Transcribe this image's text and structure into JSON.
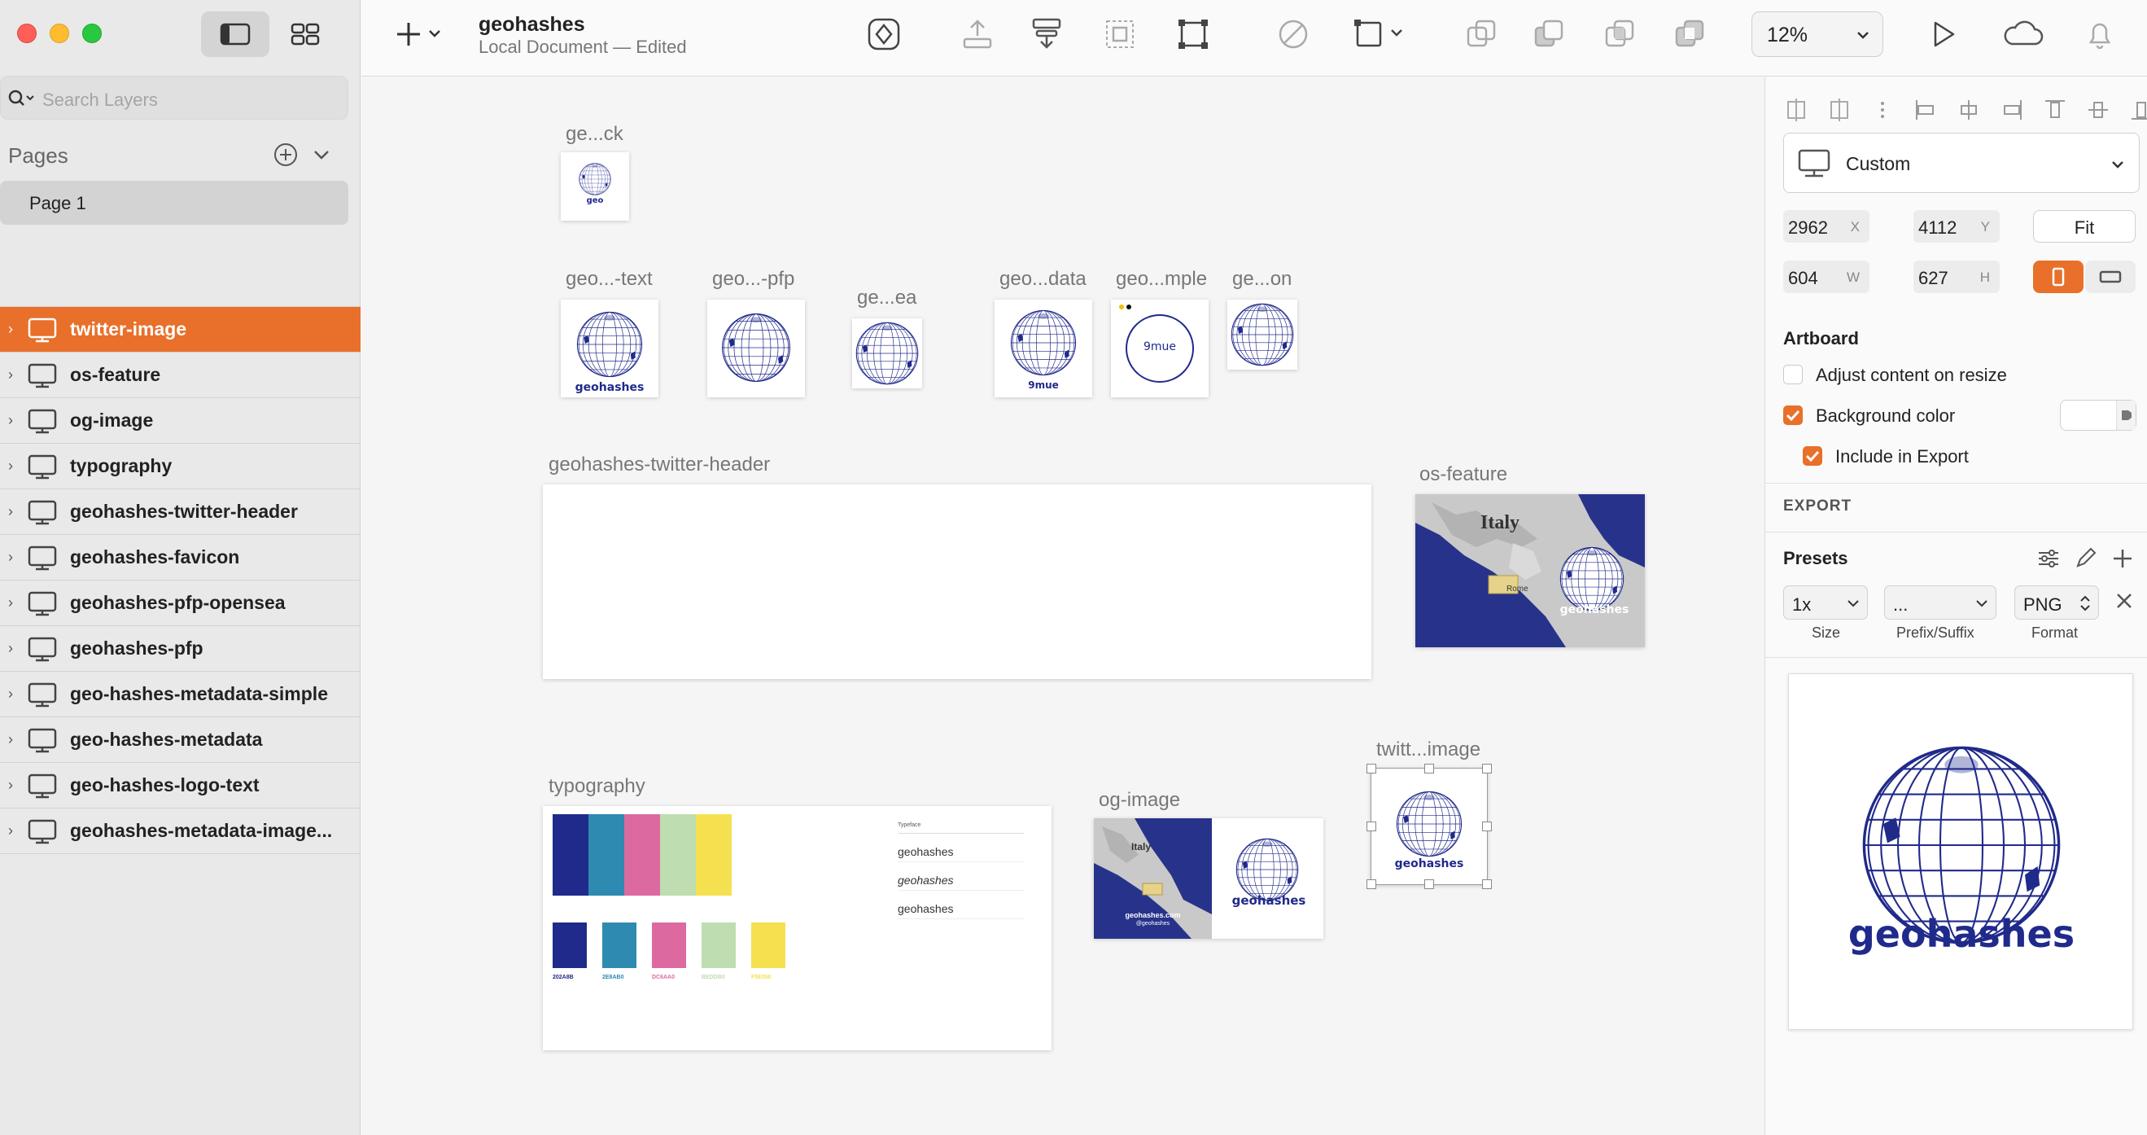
{
  "sidebar": {
    "search_placeholder": "Search Layers",
    "pages_title": "Pages",
    "pages": [
      "Page 1"
    ],
    "layers": [
      {
        "name": "twitter-image",
        "selected": true
      },
      {
        "name": "os-feature",
        "selected": false
      },
      {
        "name": "og-image",
        "selected": false
      },
      {
        "name": "typography",
        "selected": false
      },
      {
        "name": "geohashes-twitter-header",
        "selected": false
      },
      {
        "name": "geohashes-favicon",
        "selected": false
      },
      {
        "name": "geohashes-pfp-opensea",
        "selected": false
      },
      {
        "name": "geohashes-pfp",
        "selected": false
      },
      {
        "name": "geo-hashes-metadata-simple",
        "selected": false
      },
      {
        "name": "geo-hashes-metadata",
        "selected": false
      },
      {
        "name": "geo-hashes-logo-text",
        "selected": false
      },
      {
        "name": "geohashes-metadata-image..."
      }
    ]
  },
  "toolbar": {
    "doc_title": "geohashes",
    "doc_subtitle": "Local Document — Edited",
    "zoom": "12%"
  },
  "canvas": {
    "artboards": {
      "favicon_label": "ge...ck",
      "logo_text_label": "geo...-text",
      "pfp_label": "geo...-pfp",
      "opensea_label": "ge...ea",
      "metadata_label": "geo...data",
      "simple_label": "geo...mple",
      "image_label": "ge...on",
      "twitter_header_label": "geohashes-twitter-header",
      "os_feature_label": "os-feature",
      "typography_label": "typography",
      "og_image_label": "og-image",
      "twitter_image_label": "twitt...image"
    },
    "text": {
      "geo": "geo",
      "geohashes": "geohashes",
      "nine_mue": "9mue",
      "italy": "Italy",
      "rome": "Rome",
      "og_site": "geohashes.com",
      "og_handle": "@geohashes",
      "typeface": "Typeface",
      "sample": "geohashes"
    },
    "swatches": [
      {
        "hex": "#202A8B",
        "label": "202A8B"
      },
      {
        "hex": "#2E8AB0",
        "label": "2E8AB0"
      },
      {
        "hex": "#DC6AA0",
        "label": "DC6AA0"
      },
      {
        "hex": "#BEDDB0",
        "label": "BEDDB0"
      },
      {
        "hex": "#F5E050",
        "label": "F5E050"
      }
    ]
  },
  "inspector": {
    "preset_name": "Custom",
    "x_value": "2962",
    "x_label": "X",
    "y_value": "4112",
    "y_label": "Y",
    "w_value": "604",
    "w_label": "W",
    "h_value": "627",
    "h_label": "H",
    "fit_label": "Fit",
    "artboard_title": "Artboard",
    "adjust_label": "Adjust content on resize",
    "bg_label": "Background color",
    "include_label": "Include in Export",
    "export_title": "EXPORT",
    "presets_title": "Presets",
    "size_value": "1x",
    "prefix_value": "...",
    "format_value": "PNG",
    "size_caption": "Size",
    "prefix_caption": "Prefix/Suffix",
    "format_caption": "Format",
    "preview_text": "geohashes"
  },
  "colors": {
    "accent": "#e8702a",
    "brand_blue": "#202a8b",
    "map_sea": "#27338a"
  }
}
